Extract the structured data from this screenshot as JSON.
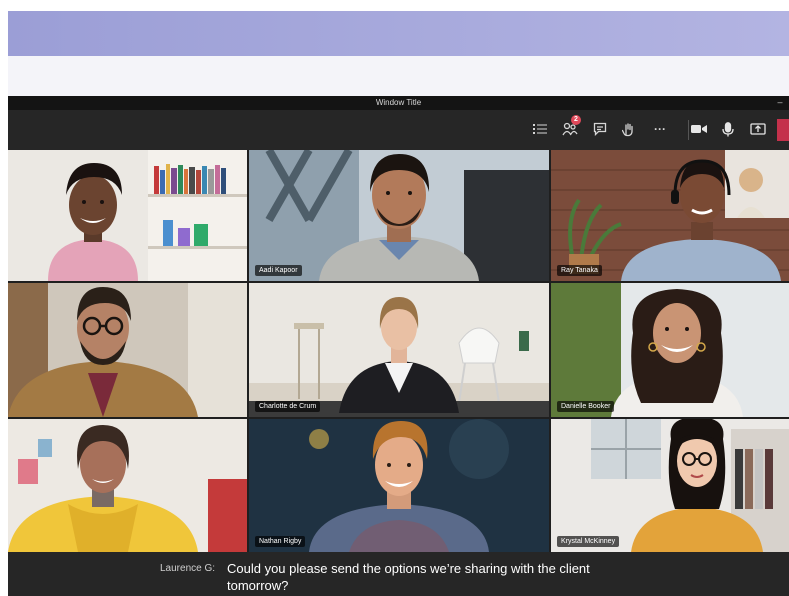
{
  "window": {
    "title": "Window Title",
    "minimize_glyph": "–"
  },
  "toolbar": {
    "buttons": [
      {
        "name": "participants-list-icon"
      },
      {
        "name": "people-icon",
        "badge": "2"
      },
      {
        "name": "chat-icon"
      },
      {
        "name": "raise-hand-icon"
      },
      {
        "name": "more-options-icon",
        "glyph": "···"
      },
      {
        "name": "camera-icon"
      },
      {
        "name": "microphone-icon"
      },
      {
        "name": "share-screen-icon"
      }
    ],
    "leave_color": "#c4314b"
  },
  "participants": [
    {
      "label": ""
    },
    {
      "label": "Aadi Kapoor"
    },
    {
      "label": "Ray Tanaka"
    },
    {
      "label": ""
    },
    {
      "label": "Charlotte de Crum"
    },
    {
      "label": "Danielle Booker"
    },
    {
      "label": ""
    },
    {
      "label": "Nathan Rigby"
    },
    {
      "label": "Krystal McKinney"
    }
  ],
  "caption": {
    "speaker": "Laurence G:",
    "text": "Could you please send the options we’re sharing with the client tomorrow?"
  },
  "colors": {
    "accent_band": "#9b9ed6",
    "badge": "#e04a5b",
    "window_bg": "#1f1f1f"
  }
}
